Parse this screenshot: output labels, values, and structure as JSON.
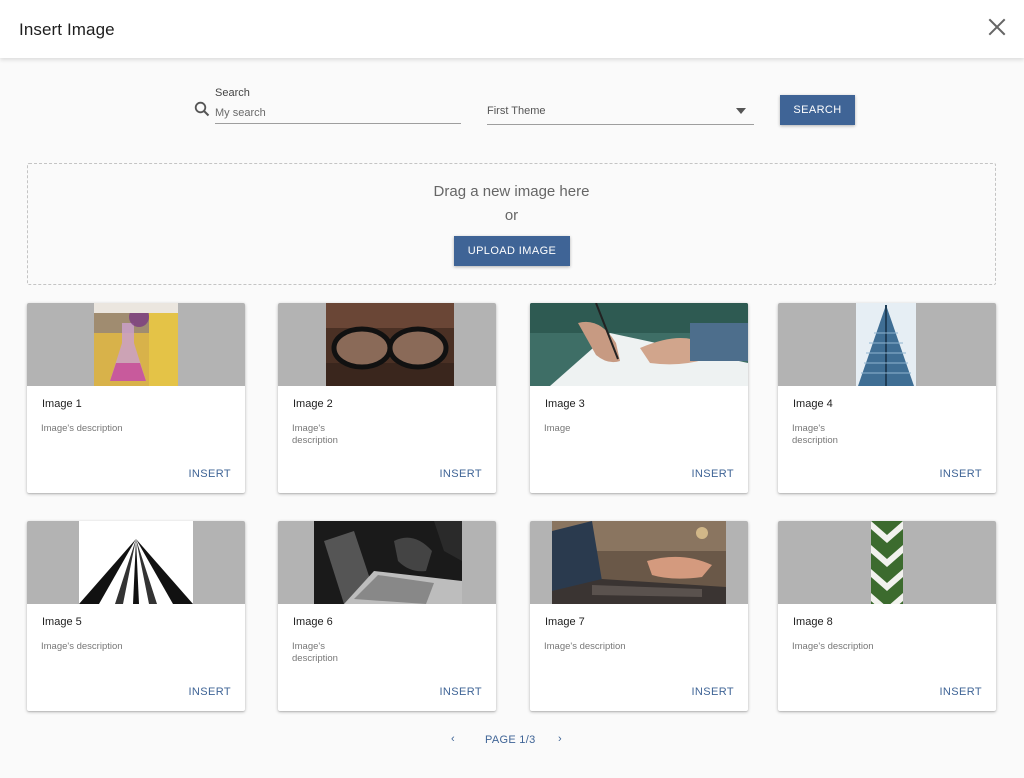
{
  "dialog": {
    "title": "Insert Image"
  },
  "search": {
    "label": "Search",
    "placeholder": "My search",
    "button_label": "SEARCH"
  },
  "theme_select": {
    "selected": "First Theme"
  },
  "dropzone": {
    "line1": "Drag a new image here",
    "line2": "or",
    "upload_label": "UPLOAD IMAGE"
  },
  "cards": [
    {
      "title": "Image 1",
      "description": "Image's description",
      "action": "INSERT",
      "image": "laboratory-flask-photo"
    },
    {
      "title": "Image 2",
      "description": "Image's description",
      "action": "INSERT",
      "image": "eyeglasses-photo"
    },
    {
      "title": "Image 3",
      "description": "Image",
      "action": "INSERT",
      "image": "hand-writing-photo"
    },
    {
      "title": "Image 4",
      "description": "Image's description",
      "action": "INSERT",
      "image": "glass-building-photo"
    },
    {
      "title": "Image 5",
      "description": "Image's description",
      "action": "INSERT",
      "image": "architecture-perspective-photo"
    },
    {
      "title": "Image 6",
      "description": "Image's description",
      "action": "INSERT",
      "image": "laptop-typing-bw-photo"
    },
    {
      "title": "Image 7",
      "description": "Image's description",
      "action": "INSERT",
      "image": "laptop-keyboard-photo"
    },
    {
      "title": "Image 8",
      "description": "Image's description",
      "action": "INSERT",
      "image": "green-chevron-pattern-photo"
    }
  ],
  "pagination": {
    "prev": "‹",
    "label": "PAGE 1/3",
    "next": "›"
  },
  "colors": {
    "accent": "#3f6496",
    "media_placeholder": "#b3b3b3",
    "header_bg": "#ffffff",
    "page_bg": "#fafafa"
  }
}
